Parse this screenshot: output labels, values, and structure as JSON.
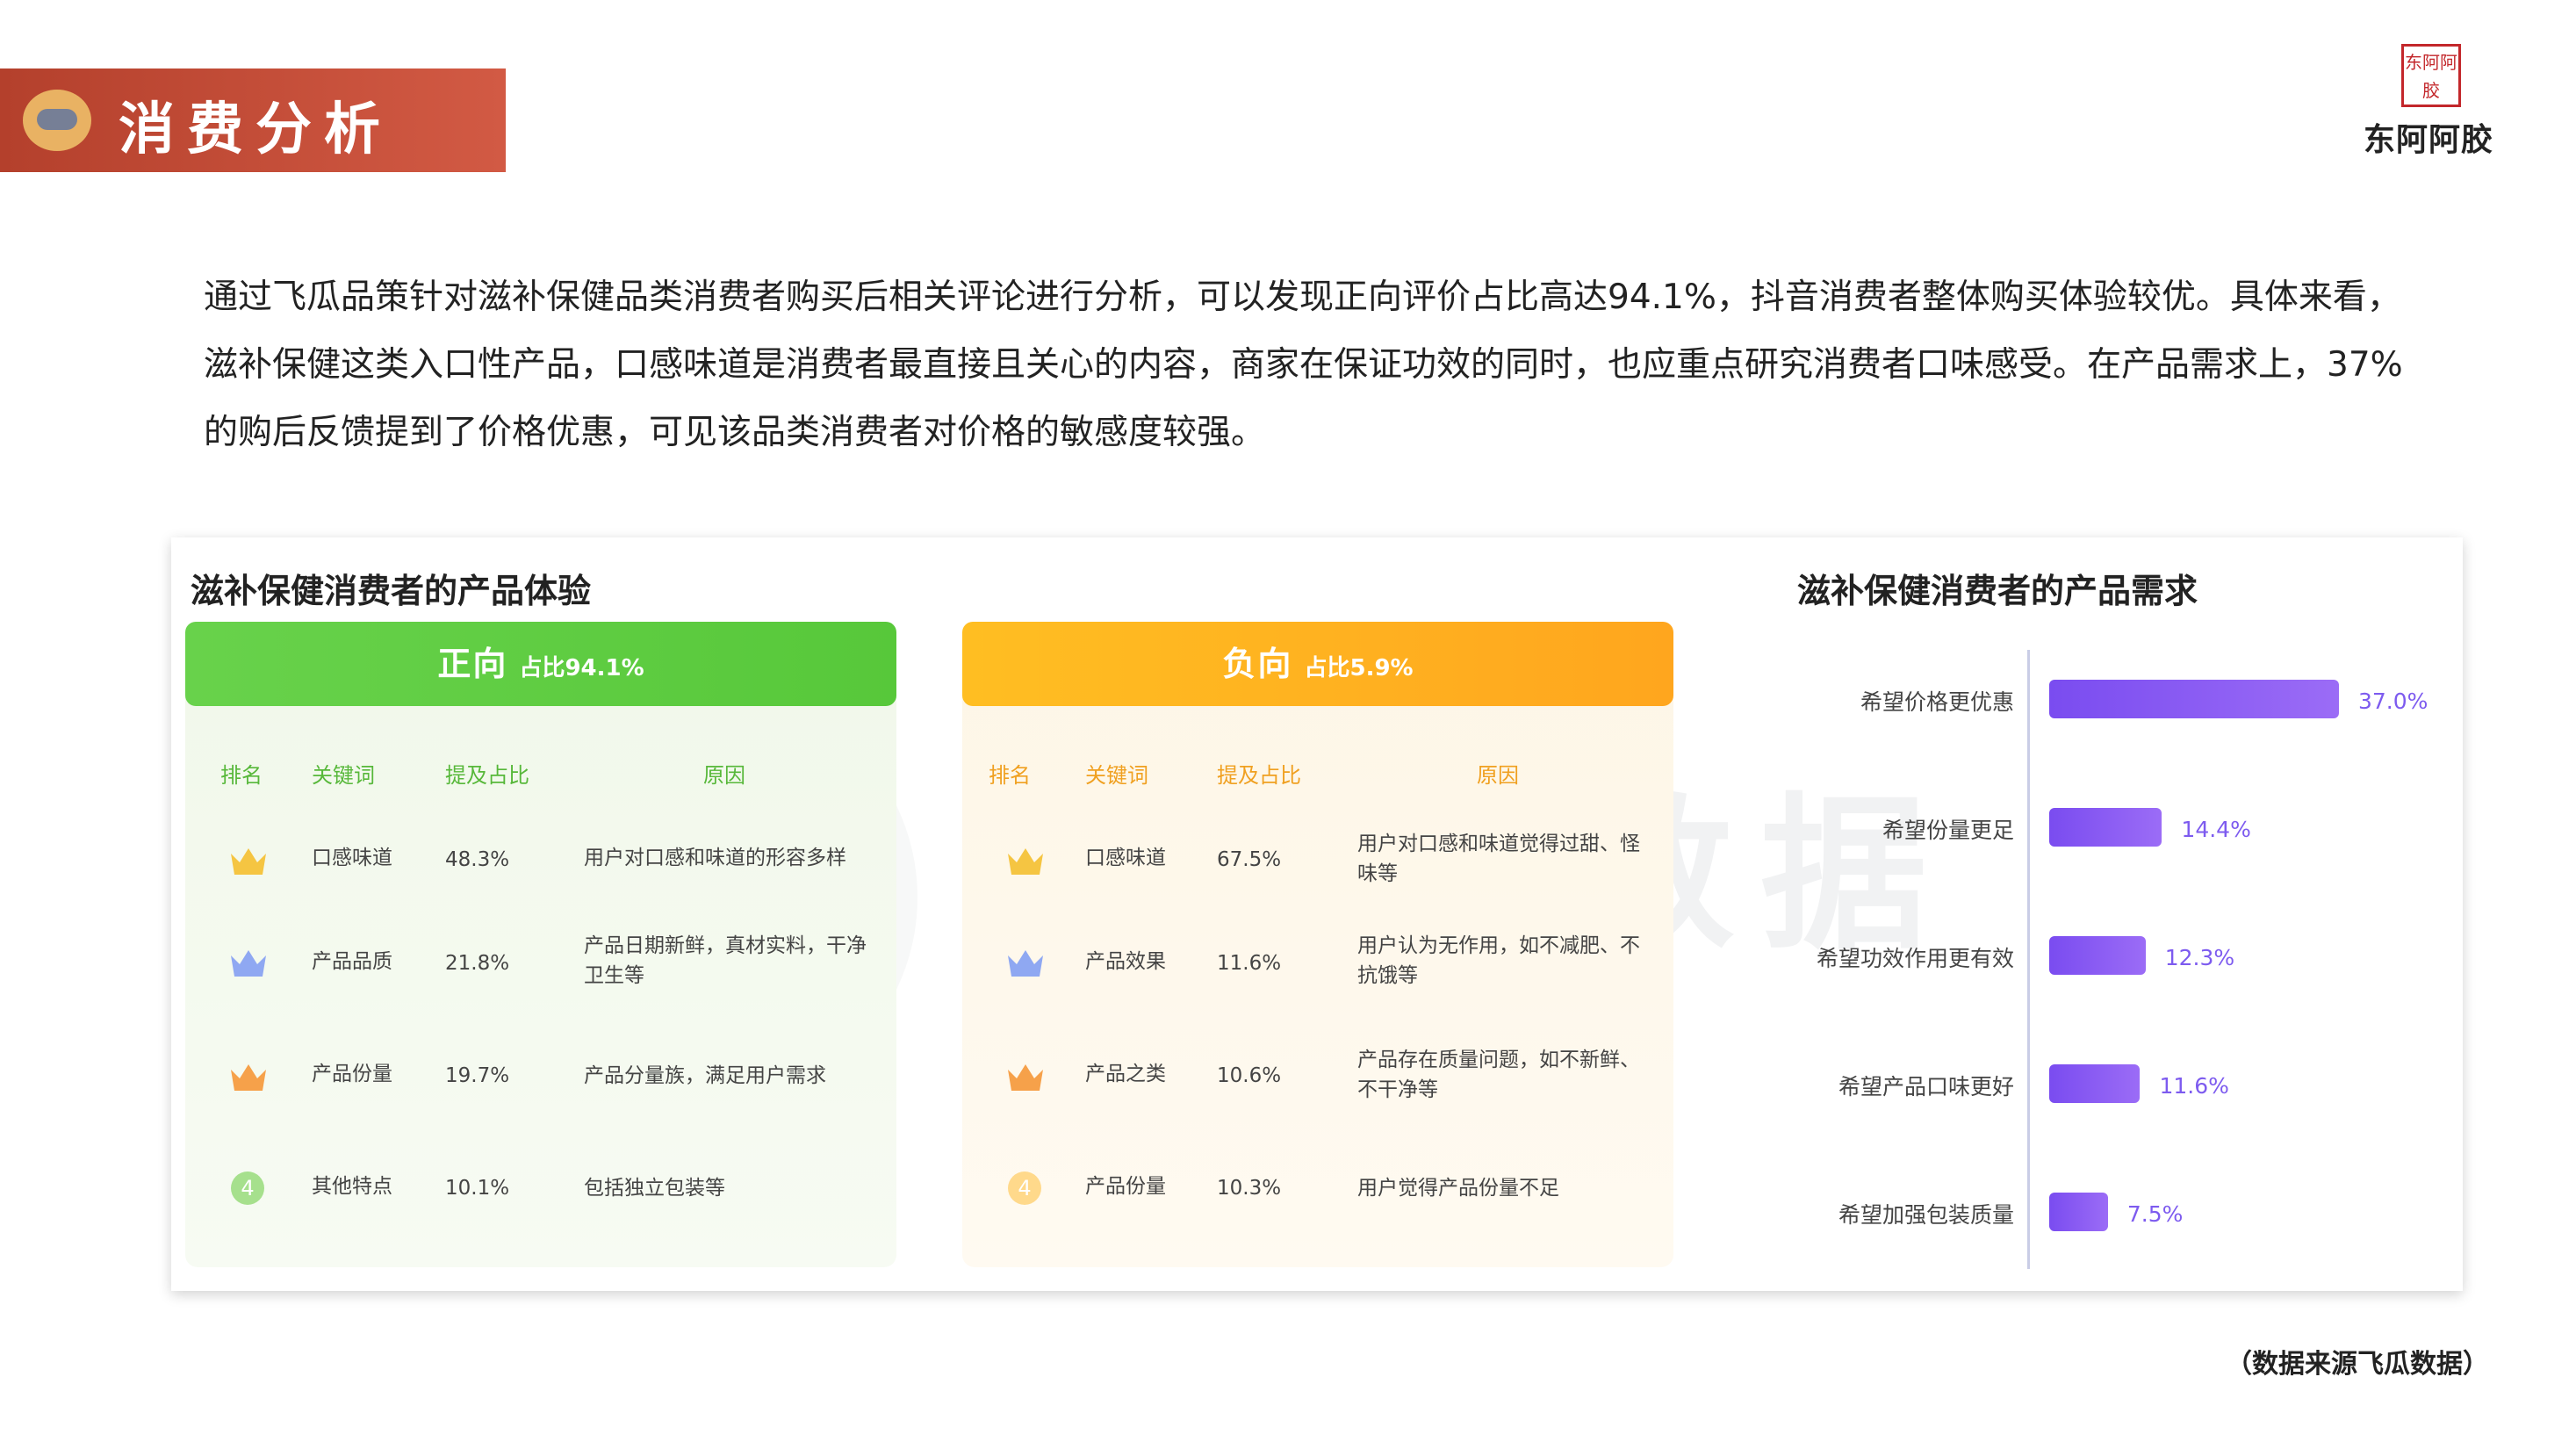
{
  "header": {
    "title": "消费分析"
  },
  "logo": {
    "mark": "东阿阿胶",
    "name": "东阿阿胶"
  },
  "intro": {
    "text": "通过飞瓜品策针对滋补保健品类消费者购买后相关评论进行分析，可以发现正向评价占比高达94.1%，抖音消费者整体购买体验较优。具体来看，滋补保健这类入口性产品，口感味道是消费者最直接且关心的内容，商家在保证功效的同时，也应重点研究消费者口味感受。在产品需求上，37%的购后反馈提到了价格优惠，可见该品类消费者对价格的敏感度较强。"
  },
  "experience": {
    "title": "滋补保健消费者的产品体验",
    "columns": {
      "rank": "排名",
      "keyword": "关键词",
      "share": "提及占比",
      "reason": "原因"
    },
    "positive": {
      "label": "正向",
      "share_label": "占比94.1%",
      "color": "#5ccb3f",
      "rows": [
        {
          "rank": "1",
          "keyword": "口感味道",
          "share": "48.3%",
          "reason": "用户对口感和味道的形容多样"
        },
        {
          "rank": "2",
          "keyword": "产品品质",
          "share": "21.8%",
          "reason": "产品日期新鲜，真材实料，干净卫生等"
        },
        {
          "rank": "3",
          "keyword": "产品份量",
          "share": "19.7%",
          "reason": "产品分量族，满足用户需求"
        },
        {
          "rank": "4",
          "keyword": "其他特点",
          "share": "10.1%",
          "reason": "包括独立包装等"
        }
      ]
    },
    "negative": {
      "label": "负向",
      "share_label": "占比5.9%",
      "color": "#ffb320",
      "rows": [
        {
          "rank": "1",
          "keyword": "口感味道",
          "share": "67.5%",
          "reason": "用户对口感和味道觉得过甜、怪味等"
        },
        {
          "rank": "2",
          "keyword": "产品效果",
          "share": "11.6%",
          "reason": "用户认为无作用，如不减肥、不抗饿等"
        },
        {
          "rank": "3",
          "keyword": "产品之类",
          "share": "10.6%",
          "reason": "产品存在质量问题，如不新鲜、不干净等"
        },
        {
          "rank": "4",
          "keyword": "产品份量",
          "share": "10.3%",
          "reason": "用户觉得产品份量不足"
        }
      ]
    },
    "crown_colors": [
      "#f5c542",
      "#8fa8f2",
      "#f6a14a"
    ]
  },
  "chart_data": {
    "type": "bar",
    "orientation": "horizontal",
    "title": "滋补保健消费者的产品需求",
    "categories": [
      "希望价格更优惠",
      "希望份量更足",
      "希望功效作用更有效",
      "希望产品口味更好",
      "希望加强包装质量"
    ],
    "values": [
      37.0,
      14.4,
      12.3,
      11.6,
      7.5
    ],
    "value_labels": [
      "37.0%",
      "14.4%",
      "12.3%",
      "11.6%",
      "7.5%"
    ],
    "xlim": [
      0,
      37.0
    ],
    "bar_color": "#8457f2",
    "grid": false
  },
  "watermark": {
    "center": "飞瓜数据"
  },
  "source": {
    "text": "（数据来源飞瓜数据）"
  }
}
